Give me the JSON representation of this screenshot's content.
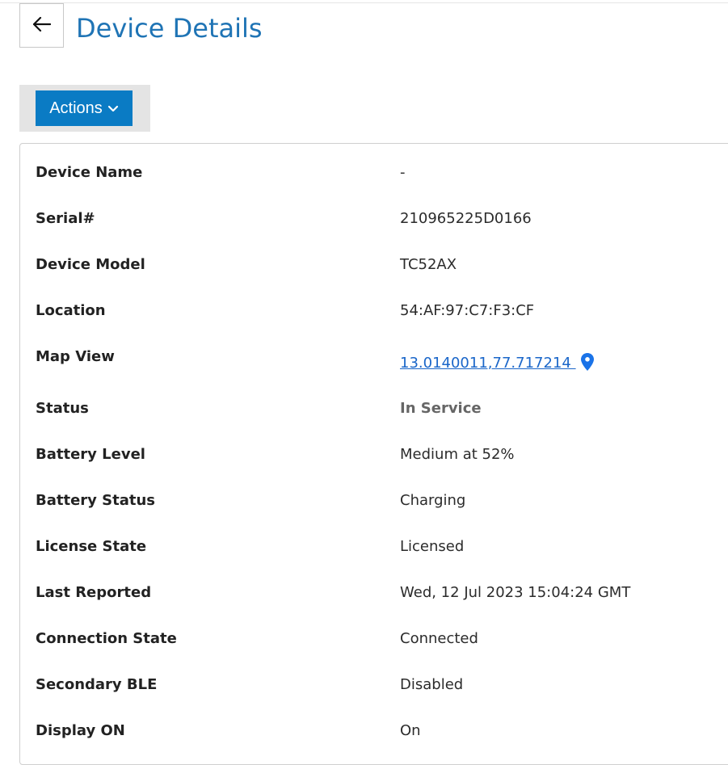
{
  "header": {
    "back_icon": "arrow-left-icon",
    "title": "Device Details"
  },
  "toolbar": {
    "actions_label": "Actions",
    "actions_icon": "chevron-down-icon"
  },
  "details": [
    {
      "label": "Device Name",
      "value": "-"
    },
    {
      "label": "Serial#",
      "value": "210965225D0166"
    },
    {
      "label": "Device Model",
      "value": "TC52AX"
    },
    {
      "label": "Location",
      "value": "54:AF:97:C7:F3:CF"
    },
    {
      "label": "Map View",
      "value": "13.0140011,77.717214 "
    },
    {
      "label": "Status",
      "value": "In Service"
    },
    {
      "label": "Battery Level",
      "value": "Medium at 52%"
    },
    {
      "label": "Battery Status",
      "value": "Charging"
    },
    {
      "label": "License State",
      "value": "Licensed"
    },
    {
      "label": "Last Reported",
      "value": "Wed, 12 Jul 2023 15:04:24 GMT"
    },
    {
      "label": "Connection State",
      "value": "Connected"
    },
    {
      "label": "Secondary BLE",
      "value": "Disabled"
    },
    {
      "label": "Display ON",
      "value": "On"
    }
  ],
  "colors": {
    "title": "#1f74b5",
    "primary_button": "#0a7bc4",
    "link": "#1a66c9",
    "pin": "#1a73e8"
  },
  "icons": {
    "map_pin": "map-pin-icon"
  }
}
